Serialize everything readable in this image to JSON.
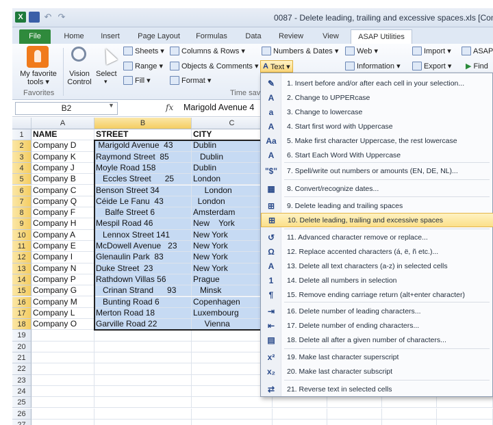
{
  "window": {
    "title": "0087 - Delete leading, trailing and excessive spaces.xls  [Compat"
  },
  "quick_access": {
    "app_icon": "X"
  },
  "tabs": [
    "File",
    "Home",
    "Insert",
    "Page Layout",
    "Formulas",
    "Data",
    "Review",
    "View",
    "ASAP Utilities"
  ],
  "ribbon": {
    "favorites_label": "My favorite tools ▾",
    "favorites_group": "Favorites",
    "vision_control": "Vision Control",
    "select": "Select",
    "select_arrow": "▾",
    "sheets": "Sheets ▾",
    "range": "Range ▾",
    "fill": "Fill ▾",
    "columns_rows": "Columns & Rows ▾",
    "objects_comments": "Objects & Comments ▾",
    "format": "Format ▾",
    "time_saving_group": "Time savi",
    "numbers_dates": "Numbers & Dates ▾",
    "web": "Web ▾",
    "text": "Text ▾",
    "information": "Information ▾",
    "import": "Import ▾",
    "export": "Export ▾",
    "asap": "ASAP",
    "find": "Find"
  },
  "formula_bar": {
    "name_box": "B2",
    "fx": "fx",
    "value": "Marigold Avenue 4"
  },
  "grid": {
    "columns": [
      "A",
      "B",
      "C"
    ],
    "header_row": [
      "NAME",
      "STREET",
      "CITY"
    ],
    "rows": [
      [
        "Company D",
        " Marigold Avenue  43",
        "Dublin"
      ],
      [
        "Company K",
        "Raymond Street  85",
        "   Dublin"
      ],
      [
        "Company J",
        "Moyle Road 158",
        "Dublin"
      ],
      [
        "Company B",
        "   Eccles Street      25",
        "London"
      ],
      [
        "Company C",
        "Benson Street 34",
        "     London"
      ],
      [
        "Company Q",
        "Céide Le Fanu  43",
        "  London"
      ],
      [
        "Company F",
        "    Balfe Street 6",
        "Amsterdam"
      ],
      [
        "Company H",
        "Mespil Road 46",
        "New    York"
      ],
      [
        "Company A",
        "   Lennox Street 141",
        "New York"
      ],
      [
        "Company E",
        "McDowell Avenue   23",
        "New York"
      ],
      [
        "Company I",
        "Glenaulin Park  83",
        "New York"
      ],
      [
        "Company N",
        "Duke Street  23",
        "New York"
      ],
      [
        "Company P",
        "Rathdown Villas 56",
        "Prague"
      ],
      [
        "Company G",
        "   Crinan Strand      93",
        "   Minsk"
      ],
      [
        "Company M",
        "   Bunting Road 6",
        "Copenhagen"
      ],
      [
        "Company L",
        "Merton Road 18",
        "Luxembourg"
      ],
      [
        "Company O",
        "Garville Road 22",
        "     Vienna"
      ]
    ],
    "row_numbers": [
      "1",
      "2",
      "3",
      "4",
      "5",
      "6",
      "7",
      "8",
      "9",
      "10",
      "11",
      "12",
      "13",
      "14",
      "15",
      "16",
      "17",
      "18",
      "19",
      "20",
      "21",
      "22",
      "23",
      "24",
      "25",
      "26",
      "27"
    ]
  },
  "menu": {
    "items": [
      {
        "icon": "✎",
        "label": "1. Insert before and/or after each cell in your selection..."
      },
      {
        "icon": "A",
        "label": "2. Change to UPPERcase"
      },
      {
        "icon": "a",
        "label": "3. Change to lowercase"
      },
      {
        "icon": "A",
        "label": "4. Start first word with Uppercase"
      },
      {
        "icon": "Aa",
        "label": "5. Make first character Uppercase, the rest lowercase"
      },
      {
        "icon": "A",
        "label": "6. Start Each Word With Uppercase"
      },
      {
        "icon": "\"$\"",
        "label": "7. Spell/write out numbers or amounts (EN, DE, NL)..."
      },
      {
        "icon": "▦",
        "label": "8. Convert/recognize dates..."
      },
      {
        "icon": "⊞",
        "label": "9. Delete leading and trailing spaces"
      },
      {
        "icon": "⊞",
        "label": "10. Delete leading, trailing and excessive spaces"
      },
      {
        "icon": "↺",
        "label": "11. Advanced character remove or replace..."
      },
      {
        "icon": "Ω",
        "label": "12. Replace accented characters (á, ë, ñ etc.)..."
      },
      {
        "icon": "A",
        "label": "13. Delete all text characters (a-z) in selected cells"
      },
      {
        "icon": "1",
        "label": "14. Delete all numbers in selection"
      },
      {
        "icon": "¶",
        "label": "15. Remove ending carriage return (alt+enter character)"
      },
      {
        "icon": "⇥",
        "label": "16. Delete number of leading characters..."
      },
      {
        "icon": "⇤",
        "label": "17. Delete number of ending characters..."
      },
      {
        "icon": "▤",
        "label": "18. Delete all after a given number of characters..."
      },
      {
        "icon": "x²",
        "label": "19. Make last character superscript"
      },
      {
        "icon": "x₂",
        "label": "20. Make last character subscript"
      },
      {
        "icon": "⇄",
        "label": "21. Reverse text in selected cells"
      }
    ]
  }
}
